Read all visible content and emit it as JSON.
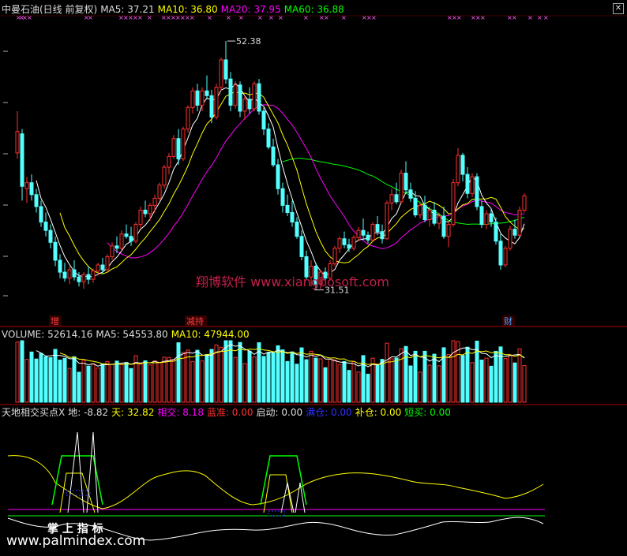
{
  "header": {
    "title": "中曼石油(日线 前复权)",
    "ma5": "MA5: 37.21",
    "ma10": "MA10: 36.80",
    "ma20": "MA20: 37.95",
    "ma60": "MA60: 36.88",
    "close_icon": "square-close-icon"
  },
  "price_labels": {
    "high": "52.38",
    "low": "31.51"
  },
  "event_markers": [
    {
      "text": "增",
      "color": "#ff4040"
    },
    {
      "text": "减持",
      "color": "#ff4040"
    },
    {
      "text": "财",
      "color": "#4aa0ff"
    }
  ],
  "volume_header": {
    "volume": "VOLUME: 52614.16",
    "ma5": "MA5: 54553.80",
    "ma10": "MA10: 47944.00"
  },
  "indicator_header": {
    "name": "天地相交买点X",
    "di": "地: -8.82",
    "tian": "天: 32.82",
    "xiangjiao": "相交: 8.18",
    "lanjun": "蓝准: 0.00",
    "qidong": "启动: 0.00",
    "jiacang": "满仓: 0.00",
    "bucang": "补仓: 0.00",
    "duanmai": "短买: 0.00"
  },
  "watermarks": {
    "center": "翔博软件 www.xiangbosoft.com",
    "bottom_cn": "掌 上 指 标",
    "bottom_url": "www.palmindex.com"
  },
  "colors": {
    "up": "#ff3030",
    "down": "#54ffff",
    "ma5": "#ffffff",
    "ma10": "#ffff00",
    "ma20": "#ff00ff",
    "ma60": "#00ff00",
    "axis": "#b00000"
  },
  "chart_data": [
    {
      "type": "candlestick",
      "title": "中曼石油(日线 前复权)",
      "series": [
        {
          "name": "MA5",
          "value": 37.21
        },
        {
          "name": "MA10",
          "value": 36.8
        },
        {
          "name": "MA20",
          "value": 37.95
        },
        {
          "name": "MA60",
          "value": 36.88
        }
      ],
      "annotations": [
        {
          "text": "52.38",
          "meaning": "period high"
        },
        {
          "text": "31.51",
          "meaning": "period low"
        }
      ],
      "ylim": [
        29.5,
        54.5
      ],
      "candles": [
        [
          43,
          46.5,
          42.5,
          44.8
        ],
        [
          44.6,
          45,
          39,
          40.2
        ],
        [
          40,
          41,
          38.8,
          40.5
        ],
        [
          40.5,
          41.2,
          39,
          39.5
        ],
        [
          39.5,
          40,
          38,
          38.5
        ],
        [
          38.5,
          39,
          36.8,
          37.2
        ],
        [
          37.2,
          38,
          36,
          36.5
        ],
        [
          36.5,
          37,
          35,
          35.5
        ],
        [
          35.5,
          36,
          33.5,
          34
        ],
        [
          34,
          34.5,
          32.5,
          33
        ],
        [
          33,
          33.8,
          32.2,
          32.5
        ],
        [
          32.5,
          33.5,
          32,
          33.2
        ],
        [
          33.2,
          34,
          32.3,
          32.6
        ],
        [
          32.6,
          33,
          31.8,
          32.2
        ],
        [
          32.2,
          33,
          31.6,
          32.8
        ],
        [
          32.8,
          33.5,
          32,
          32.4
        ],
        [
          32.4,
          33.3,
          32.1,
          33.1
        ],
        [
          33.1,
          33.8,
          32.7,
          33.6
        ],
        [
          33.6,
          34.2,
          32.9,
          33.2
        ],
        [
          33.2,
          34.5,
          33,
          34.3
        ],
        [
          34.3,
          35.5,
          34,
          35.2
        ],
        [
          35.2,
          36,
          34.6,
          35
        ],
        [
          35,
          36.5,
          34.8,
          36.2
        ],
        [
          36.2,
          37,
          35.8,
          36
        ],
        [
          36,
          36.8,
          35.2,
          35.6
        ],
        [
          35.6,
          37.2,
          35.4,
          37
        ],
        [
          37,
          38.5,
          36.7,
          38.2
        ],
        [
          38.2,
          39,
          37.6,
          37.9
        ],
        [
          37.9,
          38.8,
          37.3,
          38.6
        ],
        [
          38.6,
          39.5,
          38,
          39.2
        ],
        [
          39.2,
          40.5,
          39,
          40.3
        ],
        [
          40.3,
          42,
          40,
          41.8
        ],
        [
          41.8,
          43,
          41.2,
          42.7
        ],
        [
          42.7,
          44.5,
          42.5,
          44.2
        ],
        [
          44.2,
          45,
          42,
          42.5
        ],
        [
          42.5,
          45.2,
          42.3,
          45
        ],
        [
          45,
          47,
          44.7,
          46.8
        ],
        [
          46.8,
          48.5,
          46.3,
          48.2
        ],
        [
          48.2,
          48.8,
          46.5,
          47
        ],
        [
          47,
          48.5,
          46.5,
          48.2
        ],
        [
          48.2,
          49.5,
          47.5,
          47.8
        ],
        [
          47.8,
          48.3,
          45.5,
          46
        ],
        [
          46,
          48.8,
          45.8,
          48.5
        ],
        [
          48.5,
          51,
          48.2,
          50.8
        ],
        [
          50.8,
          52.38,
          48.8,
          49.2
        ],
        [
          49.2,
          49.8,
          46.5,
          47
        ],
        [
          47,
          49,
          46.7,
          48.7
        ],
        [
          48.7,
          49,
          46,
          46.5
        ],
        [
          46.5,
          47.8,
          45.8,
          47.5
        ],
        [
          47.5,
          48.5,
          46.3,
          46.7
        ],
        [
          46.7,
          49,
          46.5,
          48.8
        ],
        [
          48.8,
          49.2,
          46.2,
          46.5
        ],
        [
          46.5,
          46.8,
          44.5,
          45
        ],
        [
          45,
          45.5,
          43.3,
          43.5
        ],
        [
          43.5,
          44.2,
          41.8,
          42
        ],
        [
          42,
          42.5,
          39.5,
          40
        ],
        [
          40,
          40.5,
          38,
          38.6
        ],
        [
          38.6,
          39.5,
          37.7,
          38
        ],
        [
          38,
          39,
          36.8,
          37.2
        ],
        [
          37.2,
          37.6,
          35.8,
          36
        ],
        [
          36,
          36.5,
          34,
          34.3
        ],
        [
          34.3,
          34.8,
          32.4,
          32.6
        ],
        [
          32.6,
          34,
          31.8,
          33.5
        ],
        [
          33.5,
          33.8,
          31.51,
          32
        ],
        [
          32,
          33.2,
          31.6,
          33
        ],
        [
          33,
          33.4,
          32.2,
          32.5
        ],
        [
          32.5,
          34,
          32.3,
          33.7
        ],
        [
          33.7,
          35.2,
          33.5,
          35
        ],
        [
          35,
          36,
          34.6,
          35.8
        ],
        [
          35.8,
          36.4,
          35,
          35.3
        ],
        [
          35.3,
          35.8,
          34.7,
          35
        ],
        [
          35,
          36.1,
          34.8,
          35.9
        ],
        [
          35.9,
          36.8,
          35.6,
          36.5
        ],
        [
          36.5,
          37.5,
          35.7,
          36.1
        ],
        [
          36.1,
          36.4,
          35.4,
          35.7
        ],
        [
          35.7,
          37.2,
          35.6,
          37
        ],
        [
          37,
          37.7,
          36.1,
          36.4
        ],
        [
          36.4,
          37,
          35.4,
          35.8
        ],
        [
          35.8,
          39,
          35.7,
          38.8
        ],
        [
          38.8,
          40,
          38.2,
          39.5
        ],
        [
          39.5,
          40.5,
          38.7,
          38.9
        ],
        [
          38.9,
          41.6,
          38.7,
          41.3
        ],
        [
          41.3,
          42.3,
          39.6,
          39.9
        ],
        [
          39.9,
          40.5,
          38.9,
          39.2
        ],
        [
          39.2,
          39.8,
          37.6,
          37.8
        ],
        [
          37.8,
          38.8,
          37.5,
          38.6
        ],
        [
          38.6,
          39.4,
          37.2,
          37.4
        ],
        [
          37.4,
          38.5,
          36.8,
          38.2
        ],
        [
          38.2,
          38.9,
          36.9,
          37.1
        ],
        [
          37.1,
          38,
          36.6,
          37.7
        ],
        [
          37.7,
          38.5,
          35.8,
          36
        ],
        [
          36,
          37.3,
          35.1,
          37
        ],
        [
          37,
          40.8,
          36.8,
          40.5
        ],
        [
          40.5,
          43.4,
          40.2,
          42.8
        ],
        [
          42.8,
          43,
          40.6,
          41.2
        ],
        [
          41.2,
          41.8,
          39.2,
          39.6
        ],
        [
          39.6,
          41.3,
          39.3,
          41
        ],
        [
          41,
          41.3,
          38.2,
          38.5
        ],
        [
          38.5,
          39,
          36.7,
          37
        ],
        [
          37,
          38.2,
          36.6,
          37.9
        ],
        [
          37.9,
          38.3,
          36.8,
          37.2
        ],
        [
          37.2,
          37.6,
          35.3,
          35.6
        ],
        [
          35.6,
          36.2,
          33.2,
          33.6
        ],
        [
          33.6,
          35.2,
          33.4,
          35
        ],
        [
          35,
          36.9,
          34.8,
          36.6
        ],
        [
          36.6,
          37.4,
          35.8,
          36.1
        ],
        [
          36.1,
          38.5,
          36,
          38.2
        ],
        [
          38.2,
          39.6,
          38,
          39.4
        ]
      ]
    },
    {
      "type": "bar",
      "title": "VOLUME",
      "series": [
        {
          "name": "VOLUME",
          "value": 52614.16
        },
        {
          "name": "MA5",
          "value": 54553.8
        },
        {
          "name": "MA10",
          "value": 47944.0
        }
      ]
    },
    {
      "type": "line",
      "title": "天地相交买点X",
      "series": [
        {
          "name": "地",
          "value": -8.82
        },
        {
          "name": "天",
          "value": 32.82
        },
        {
          "name": "相交",
          "value": 8.18
        },
        {
          "name": "蓝准",
          "value": 0.0
        },
        {
          "name": "启动",
          "value": 0.0
        },
        {
          "name": "满仓",
          "value": 0.0
        },
        {
          "name": "补仓",
          "value": 0.0
        },
        {
          "name": "短买",
          "value": 0.0
        }
      ]
    }
  ]
}
